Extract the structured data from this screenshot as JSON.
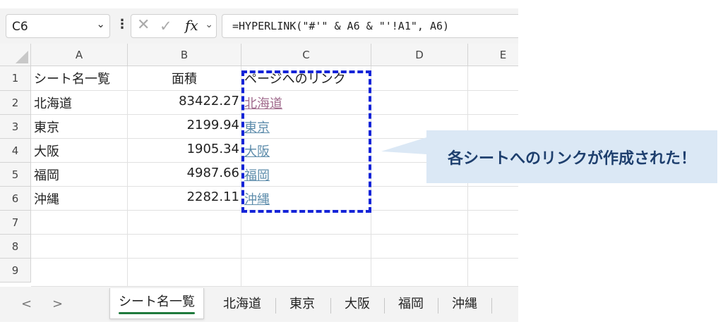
{
  "formula_bar": {
    "cell_ref": "C6",
    "formula": "=HYPERLINK(\"#'\" & A6 & \"'!A1\", A6)",
    "icons": [
      "chevron-down-icon",
      "more-vertical-icon",
      "cancel-icon",
      "enter-icon",
      "function-icon"
    ]
  },
  "sheet": {
    "columns": [
      "A",
      "B",
      "C",
      "D",
      "E"
    ],
    "row_numbers": [
      "1",
      "2",
      "3",
      "4",
      "5",
      "6",
      "7",
      "8",
      "9"
    ],
    "header_row": {
      "a": "シート名一覧",
      "b": "面積",
      "c": "ページへのリンク"
    },
    "rows": [
      {
        "a": "北海道",
        "b": "83422.27",
        "c": "北海道"
      },
      {
        "a": "東京",
        "b": "2199.94",
        "c": "東京"
      },
      {
        "a": "大阪",
        "b": "1905.34",
        "c": "大阪"
      },
      {
        "a": "福岡",
        "b": "4987.66",
        "c": "福岡"
      },
      {
        "a": "沖縄",
        "b": "2282.11",
        "c": "沖縄"
      }
    ],
    "link_colors": {
      "visited": "#a06a8c",
      "normal": "#5d8cab"
    },
    "highlight_color": "#1424d8"
  },
  "tabs": {
    "nav_prev": "<",
    "nav_next": ">",
    "items": [
      "シート名一覧",
      "北海道",
      "東京",
      "大阪",
      "福岡",
      "沖縄"
    ],
    "active_index": 0
  },
  "callout": {
    "text": "各シートへのリンクが作成された！",
    "bg_color": "#dbe8f5"
  }
}
